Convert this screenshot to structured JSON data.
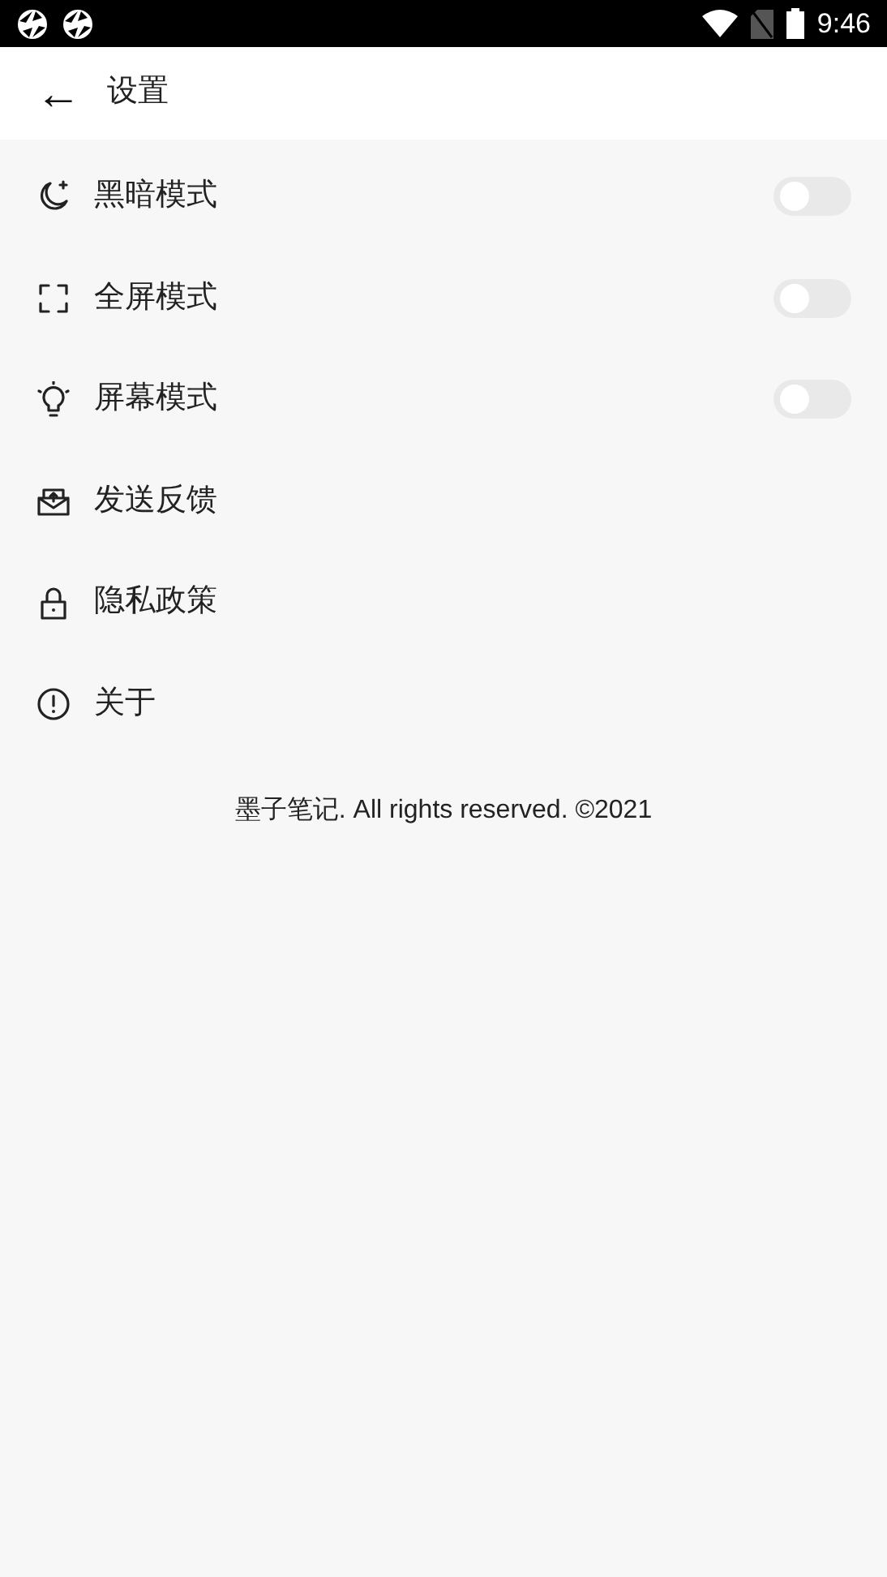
{
  "status_bar": {
    "time": "9:46"
  },
  "header": {
    "back": "←",
    "title": "设置"
  },
  "items": [
    {
      "kind": "toggle",
      "label": "黑暗模式",
      "on": false
    },
    {
      "kind": "toggle",
      "label": "全屏模式",
      "on": false
    },
    {
      "kind": "toggle",
      "label": "屏幕模式",
      "on": false
    },
    {
      "kind": "link",
      "label": "发送反馈"
    },
    {
      "kind": "link",
      "label": "隐私政策"
    },
    {
      "kind": "link",
      "label": "关于"
    }
  ],
  "footer": "墨子笔记. All rights reserved. ©2021"
}
